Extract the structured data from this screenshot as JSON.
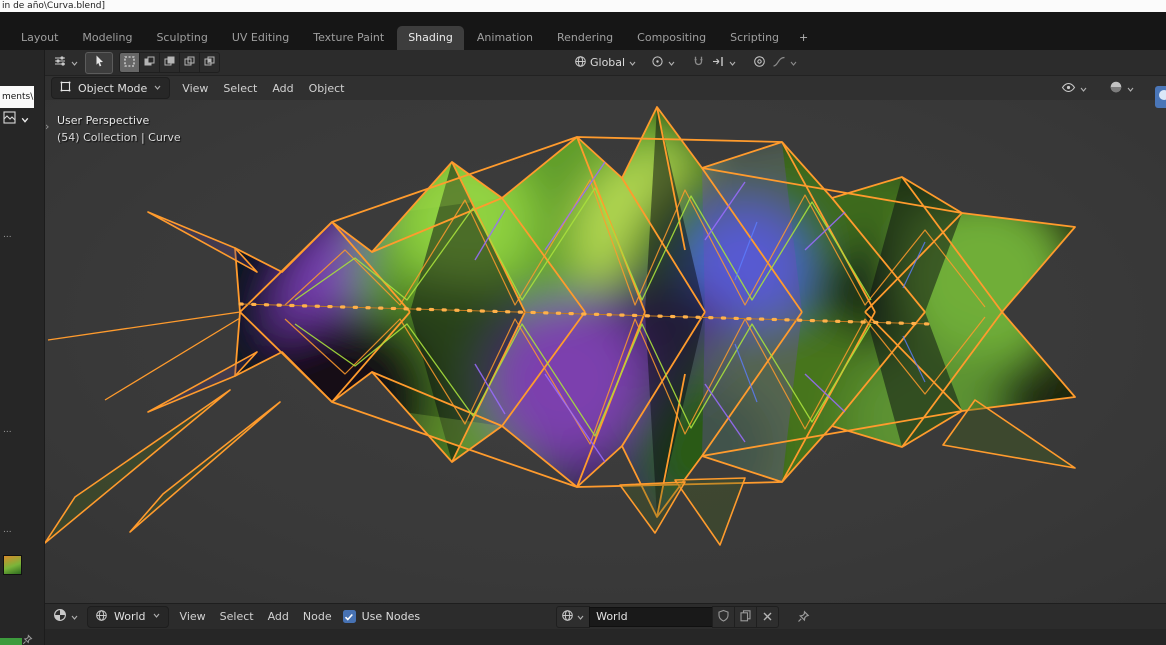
{
  "window": {
    "title": "in de año\\Curva.blend]"
  },
  "topbar": {
    "tabs": [
      "Layout",
      "Modeling",
      "Sculpting",
      "UV Editing",
      "Texture Paint",
      "Shading",
      "Animation",
      "Rendering",
      "Compositing",
      "Scripting"
    ],
    "active_tab": "Shading",
    "new_tab_label": "+"
  },
  "tool_header": {
    "orientation_label": "Global"
  },
  "viewport_header": {
    "mode_label": "Object Mode",
    "menus": [
      "View",
      "Select",
      "Add",
      "Object"
    ]
  },
  "viewport_overlay": {
    "line1": "User Perspective",
    "line2": "(54) Collection | Curve"
  },
  "left_panel": {
    "path_text": "ments\\",
    "items": [
      "...",
      "...",
      "..."
    ]
  },
  "shader_editor": {
    "context_label": "World",
    "menus": [
      "View",
      "Select",
      "Add",
      "Node"
    ],
    "use_nodes_label": "Use Nodes",
    "id_name": "World"
  },
  "colors": {
    "selection_orange": "#ff9b2d",
    "accent_blue": "#4772b3",
    "viewport_gray": "#3a3a3a"
  }
}
